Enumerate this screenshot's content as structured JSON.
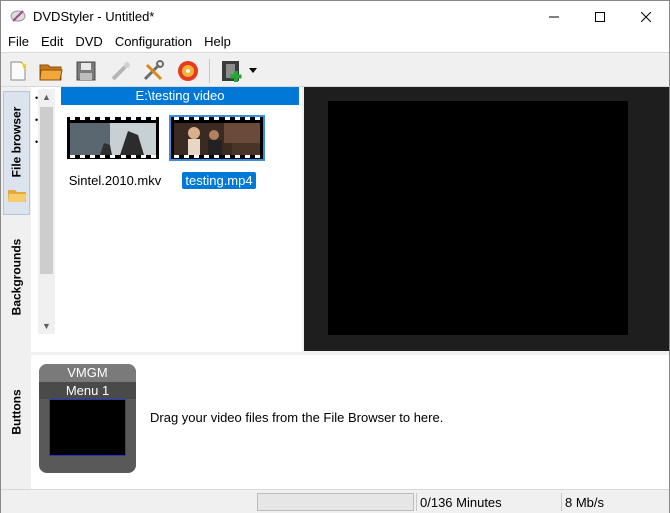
{
  "window": {
    "title": "DVDStyler - Untitled*"
  },
  "menu": [
    "File",
    "Edit",
    "DVD",
    "Configuration",
    "Help"
  ],
  "toolbar": {
    "buttons": [
      "new-icon",
      "open-folder-icon",
      "save-icon",
      "wand-icon",
      "tools-icon",
      "burn-disc-icon",
      "add-video-icon",
      "dropdown-arrow-icon"
    ]
  },
  "tabs": {
    "file_browser": "File browser",
    "backgrounds": "Backgrounds",
    "buttons": "Buttons"
  },
  "file_browser": {
    "path": "E:\\testing video",
    "files": [
      {
        "name": "Sintel.2010.mkv",
        "selected": false
      },
      {
        "name": "testing.mp4",
        "selected": true
      }
    ]
  },
  "titleset": {
    "vmgm": "VMGM",
    "menu": "Menu 1",
    "hint": "Drag your video files from the File Browser to here."
  },
  "status": {
    "progress": 0,
    "minutes": "0/136 Minutes",
    "rate": "8 Mb/s"
  },
  "colors": {
    "selection": "#0078d7",
    "preview_bg": "#1e1e1e",
    "menu_border": "#2a36c8"
  }
}
